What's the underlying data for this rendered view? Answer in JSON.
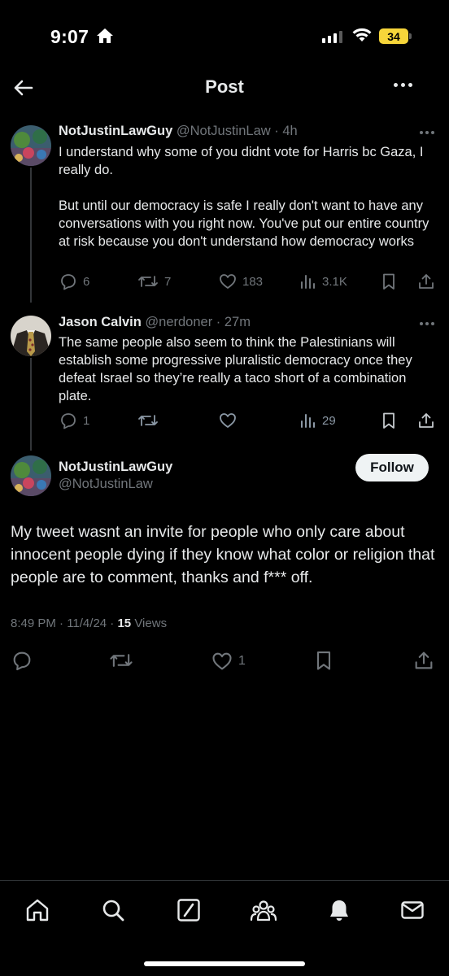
{
  "status": {
    "time": "9:07",
    "battery": "34"
  },
  "nav": {
    "title": "Post"
  },
  "tweets": [
    {
      "name": "NotJustinLawGuy",
      "meta": "@NotJustinLaw · 4h",
      "paragraphs": [
        "I understand why some of you didnt vote for Harris bc Gaza, I really do.",
        "But until our democracy is safe I really don't want to have any conversations with you right now. You've put our entire country at risk because you don't understand how democracy works"
      ],
      "replies": "6",
      "reposts": "7",
      "likes": "183",
      "views": "3.1K"
    },
    {
      "name": "Jason Calvin",
      "meta": "@nerdoner · 27m",
      "paragraphs": [
        "The same people also seem to think the Palestinians will establish some progressive pluralistic democracy once they defeat Israel so they’re really a taco short of a combination plate."
      ],
      "replies": "1",
      "reposts": "",
      "likes": "",
      "views": "29"
    }
  ],
  "main": {
    "name": "NotJustinLawGuy",
    "handle": "@NotJustinLaw",
    "follow_label": "Follow",
    "text": "My tweet wasnt an invite for people who only care about innocent people dying if they know what color or religion that people are to comment, thanks and f*** off.",
    "timestamp": "8:49 PM · 11/4/24 · ",
    "views_count": "15",
    "views_label": " Views",
    "likes": "1"
  },
  "colors": {
    "accent_text": "#e7e9ea",
    "muted": "#71767b",
    "background": "#000000",
    "battery": "#f6d53a"
  },
  "icons": [
    "home-icon",
    "search-icon",
    "grok-icon",
    "communities-icon",
    "notifications-icon",
    "messages-icon"
  ]
}
